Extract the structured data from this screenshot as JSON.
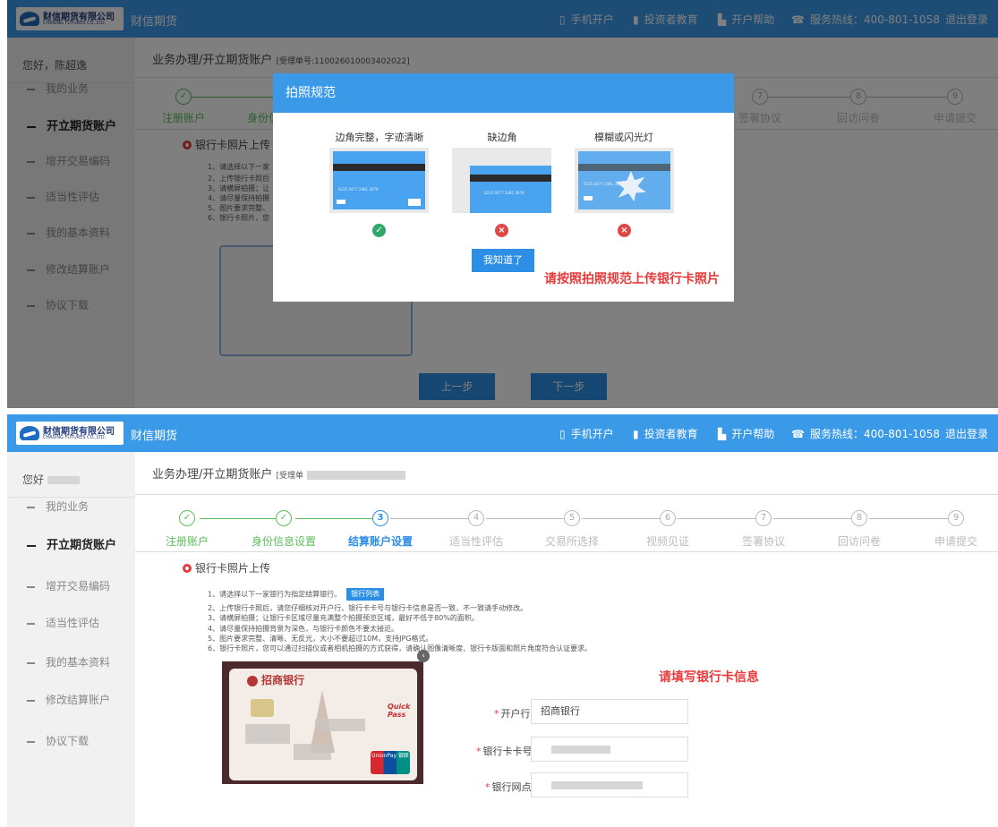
{
  "header": {
    "logo_cn": "财信期货有限公司",
    "logo_en": "CHASING FUTURES CO.,LTD.",
    "brand": "财信期货",
    "nav": [
      {
        "icon": "mobile-icon",
        "label": "手机开户"
      },
      {
        "icon": "bar-chart-icon",
        "label": "投资者教育"
      },
      {
        "icon": "bookmark-icon",
        "label": "开户帮助"
      },
      {
        "icon": "phone-icon",
        "label": "服务热线：400-801-1058"
      },
      {
        "label": "退出登录"
      }
    ]
  },
  "sidebar": {
    "greeting_top": "您好，陈超逸",
    "greeting_bottom": "您好",
    "items": [
      {
        "label": "我的业务"
      },
      {
        "label": "开立期货账户",
        "active": true
      },
      {
        "label": "增开交易编码"
      },
      {
        "label": "适当性评估"
      },
      {
        "label": "我的基本资料"
      },
      {
        "label": "修改结算账户"
      },
      {
        "label": "协议下载"
      }
    ]
  },
  "breadcrumb": {
    "path": "业务办理/开立期货账户",
    "receipt_top": "[受理单号:110026010003402022]",
    "receipt_bottom": "[受理单"
  },
  "steps": [
    {
      "num": "1",
      "label": "注册账户",
      "status": "done"
    },
    {
      "num": "2",
      "label": "身份信息设置",
      "status": "done"
    },
    {
      "num": "3",
      "label": "结算账户设置",
      "status": "current"
    },
    {
      "num": "4",
      "label": "适当性评估",
      "status": "todo"
    },
    {
      "num": "5",
      "label": "交易所选择",
      "status": "todo"
    },
    {
      "num": "6",
      "label": "视频见证",
      "status": "todo"
    },
    {
      "num": "7",
      "label": "签署协议",
      "status": "todo"
    },
    {
      "num": "8",
      "label": "回访问卷",
      "status": "todo"
    },
    {
      "num": "9",
      "label": "申请提交",
      "status": "todo"
    }
  ],
  "upload": {
    "title": "银行卡照片上传",
    "bank_list_button": "银行列表",
    "instructions": [
      "1、请选择以下一家银行为指定结算银行。",
      "2、上传银行卡照后，请您仔细核对开户行、银行卡卡号与银行卡信息是否一致，不一致请手动修改。",
      "3、请横屏拍摄；让银行卡区域尽量充满整个拍摄预览区域，最好不低于80%的面积。",
      "4、请尽量保持拍摄背景为深色，与银行卡颜色不要太接近。",
      "5、图片要求完整、清晰、无反光，大小不要超过10M，支持JPG格式。",
      "6、银行卡照片，您可以通过扫描仪或者相机拍摄的方式获得，请确认图像清晰度、银行卡版面和照片角度符合认证要求。"
    ],
    "instructions_top_partial": [
      "1、请选择以下一家",
      "2、上传银行卡照后",
      "3、请横屏拍摄；让",
      "4、请尽量保持拍摄",
      "5、图片要求完整、",
      "6、银行卡照片，您"
    ]
  },
  "buttons": {
    "prev": "上一步",
    "next": "下一步"
  },
  "modal": {
    "title": "拍照规范",
    "samples": [
      {
        "caption": "边角完整，字迹清晰",
        "result": "ok"
      },
      {
        "caption": "缺边角",
        "result": "bad"
      },
      {
        "caption": "模糊或闪光灯",
        "result": "bad"
      }
    ],
    "sample_card_number": "6225 0477 2481 3076",
    "confirm_button": "我知道了",
    "annotation": "请按照拍照规范上传银行卡照片"
  },
  "card_photo": {
    "bank_name": "招商银行",
    "quickpass": "Quick Pass",
    "unionpay": "UnionPay 银联"
  },
  "form": {
    "annotation": "请填写银行卡信息",
    "fields": [
      {
        "label": "开户行",
        "value": "招商银行"
      },
      {
        "label": "银行卡卡号",
        "value": ""
      },
      {
        "label": "银行网点",
        "value": ""
      }
    ]
  },
  "colors": {
    "header": "#3b9ae8",
    "accent": "#2d8ee6",
    "done": "#5bbf5b",
    "error": "#e83a3a"
  }
}
